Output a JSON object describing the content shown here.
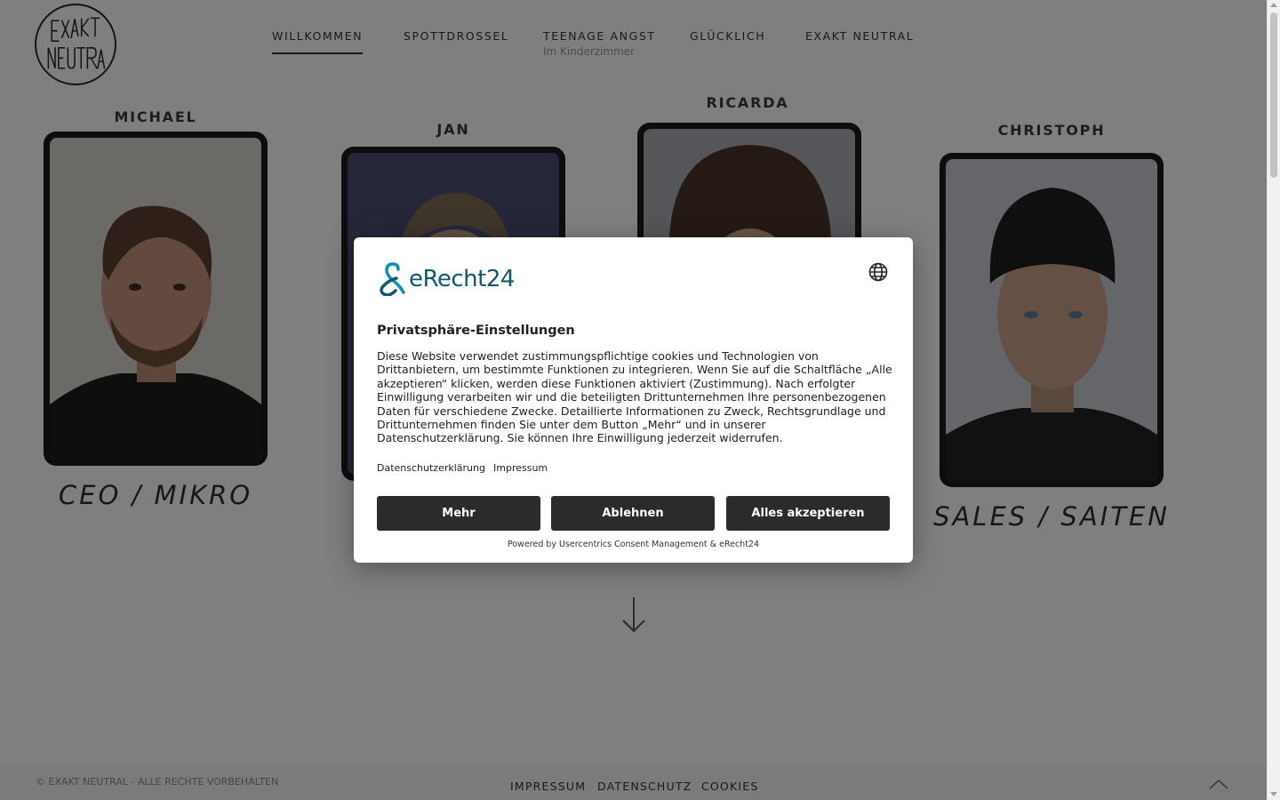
{
  "logo": {
    "text": "EXAKT NEUTRAL"
  },
  "nav": {
    "items": [
      {
        "label": "WILLKOMMEN"
      },
      {
        "label": "SPOTTDROSSEL"
      },
      {
        "label": "TEENAGE ANGST"
      },
      {
        "label": "GLÜCKLICH"
      },
      {
        "label": "EXAKT NEUTRAL"
      }
    ],
    "sub_label": "Im Kinderzimmer"
  },
  "members": [
    {
      "name": "MICHAEL",
      "role": "CEO / MIKRO"
    },
    {
      "name": "JAN",
      "role": ""
    },
    {
      "name": "RICARDA",
      "role": ""
    },
    {
      "name": "CHRISTOPH",
      "role": "SALES / SAITEN"
    }
  ],
  "footer": {
    "copyright": "© EXAKT NEUTRAL - ALLE RECHTE VORBEHALTEN",
    "links": [
      "IMPRESSUM",
      "DATENSCHUTZ",
      "COOKIES"
    ]
  },
  "consent": {
    "brand": "eRecht24",
    "title": "Privatsphäre-Einstellungen",
    "body": "Diese Website verwendet zustimmungspflichtige cookies und Technologien von Drittanbietern, um bestimmte Funktionen zu integrieren. Wenn Sie auf die Schaltfläche „Alle akzeptieren“ klicken, werden diese Funktionen aktiviert (Zustimmung). Nach erfolgter Einwilligung verarbeiten wir und die beteiligten Drittunternehmen Ihre personenbezogenen Daten für verschiedene Zwecke. Detaillierte Informationen zu Zweck, Rechtsgrundlage und Drittunternehmen finden Sie unter dem Button „Mehr“ und in unserer Datenschutzerklärung. Sie können Ihre Einwilligung jederzeit widerrufen.",
    "links": {
      "privacy": "Datenschutzerklärung",
      "imprint": "Impressum"
    },
    "buttons": {
      "more": "Mehr",
      "decline": "Ablehnen",
      "accept_all": "Alles akzeptieren"
    },
    "powered_by": "Powered by Usercentrics Consent Management & eRecht24"
  },
  "colors": {
    "brand_teal": "#10596e",
    "button_dark": "#2b2b2b",
    "frame_dark": "#1b1b1b"
  }
}
